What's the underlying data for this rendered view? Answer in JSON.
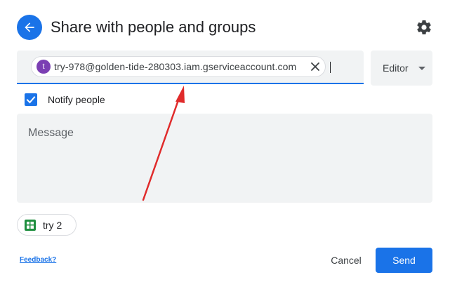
{
  "dialog": {
    "title": "Share with people and groups",
    "back_icon": "arrow-left-icon",
    "settings_icon": "gear-icon"
  },
  "recipients": {
    "chips": [
      {
        "avatar_letter": "t",
        "email": "try-978@golden-tide-280303.iam.gserviceaccount.com"
      }
    ]
  },
  "role": {
    "selected": "Editor"
  },
  "notify": {
    "label": "Notify people",
    "checked": true
  },
  "message": {
    "placeholder": "Message"
  },
  "document": {
    "name": "try 2",
    "icon": "sheets-icon"
  },
  "footer": {
    "feedback_label": "Feedback?",
    "cancel_label": "Cancel",
    "send_label": "Send"
  },
  "colors": {
    "accent": "#1a73e8",
    "field_bg": "#f1f3f4",
    "avatar": "#7b3fb3",
    "annotation_arrow": "#e02b2b",
    "sheets_green": "#1e8e3e"
  }
}
